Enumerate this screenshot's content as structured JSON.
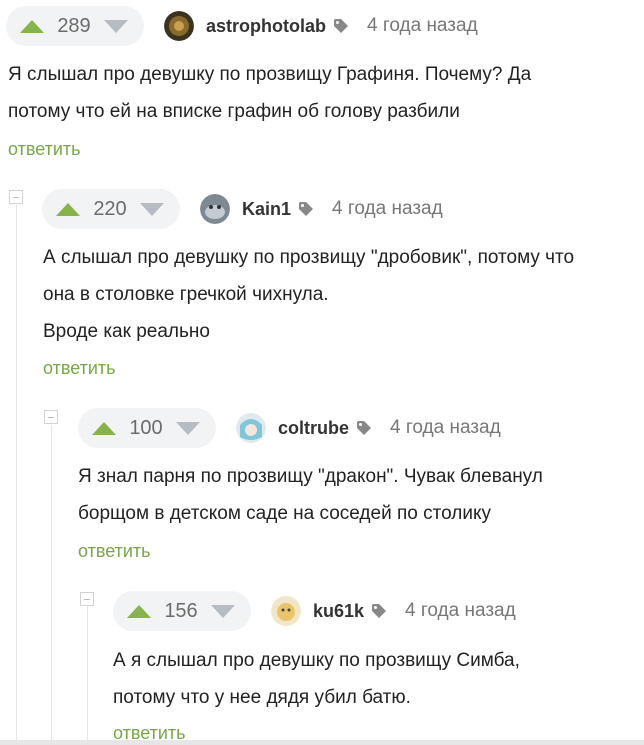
{
  "reply_label": "ответить",
  "comments": [
    {
      "votes": "289",
      "author": "astrophotolab",
      "time": "4 года назад",
      "lines": [
        "Я слышал про девушку по прозвищу Графиня. Почему? Да",
        "потому что ей на вписке графин об голову разбили"
      ]
    },
    {
      "votes": "220",
      "author": "Kain1",
      "time": "4 года назад",
      "lines": [
        "А слышал про девушку по прозвищу \"дробовик\", потому что",
        "она в столовке гречкой чихнула.",
        "Вроде как реально"
      ]
    },
    {
      "votes": "100",
      "author": "coltrube",
      "time": "4 года назад",
      "lines": [
        "Я знал парня по прозвищу \"дракон\". Чувак блеванул",
        "борщом в детском саде на соседей по столику"
      ]
    },
    {
      "votes": "156",
      "author": "ku61k",
      "time": "4 года назад",
      "lines": [
        "А я слышал про девушку по прозвищу Симба,",
        "потому что у нее дядя убил батю."
      ]
    }
  ],
  "colors": {
    "accent": "#78a647",
    "upvote": "#86b34a",
    "downvote": "#b6bcc2"
  },
  "icons": [
    "arrow-up-icon",
    "arrow-down-icon",
    "tag-icon",
    "collapse-icon"
  ]
}
